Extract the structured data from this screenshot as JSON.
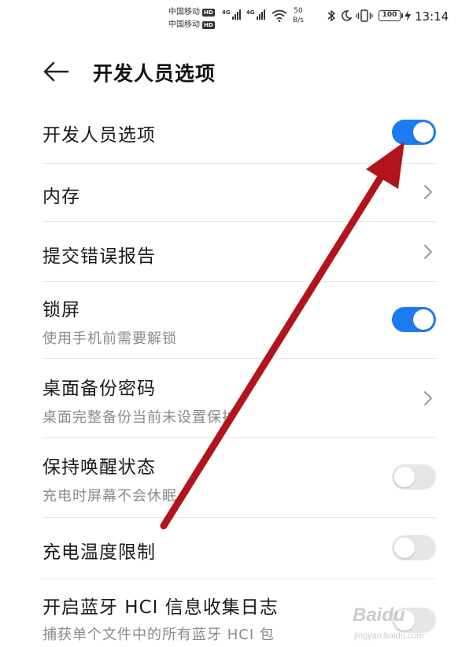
{
  "status_bar": {
    "carrier_1": "中国移动",
    "carrier_2": "中国移动",
    "hd_badge": "HD",
    "signal_1_tag": "4G",
    "signal_2_tag": "4G",
    "net_speed_value": "50",
    "net_speed_unit": "B/s",
    "battery_level": "100",
    "time": "13:14"
  },
  "header": {
    "title": "开发人员选项"
  },
  "settings": [
    {
      "title": "开发人员选项",
      "subtitle": "",
      "control": "toggle",
      "state": "on"
    },
    {
      "title": "内存",
      "subtitle": "",
      "control": "chevron",
      "state": ""
    },
    {
      "title": "提交错误报告",
      "subtitle": "",
      "control": "chevron",
      "state": ""
    },
    {
      "title": "锁屏",
      "subtitle": "使用手机前需要解锁",
      "control": "toggle",
      "state": "on"
    },
    {
      "title": "桌面备份密码",
      "subtitle": "桌面完整备份当前未设置保护",
      "control": "chevron",
      "state": ""
    },
    {
      "title": "保持唤醒状态",
      "subtitle": "充电时屏幕不会休眠",
      "control": "toggle",
      "state": "off"
    },
    {
      "title": "充电温度限制",
      "subtitle": "",
      "control": "toggle",
      "state": "off"
    },
    {
      "title": "开启蓝牙 HCI 信息收集日志",
      "subtitle": "捕获单个文件中的所有蓝牙 HCI 包",
      "control": "toggle",
      "state": "off"
    }
  ],
  "watermark": {
    "brand": "Baidu",
    "url": "jingyan.baidu.com"
  },
  "colors": {
    "toggle_on": "#1a7cf0",
    "toggle_off": "#e6e6e6",
    "annotation_arrow": "#b3141c",
    "subtitle_text": "#8a8a8a"
  },
  "icons": {
    "back": "arrow-left-icon",
    "chevron": "chevron-right-icon",
    "bluetooth": "bluetooth-icon",
    "dnd": "moon-icon",
    "vibrate": "vibrate-icon",
    "wifi": "wifi-icon",
    "charging": "bolt-icon"
  }
}
